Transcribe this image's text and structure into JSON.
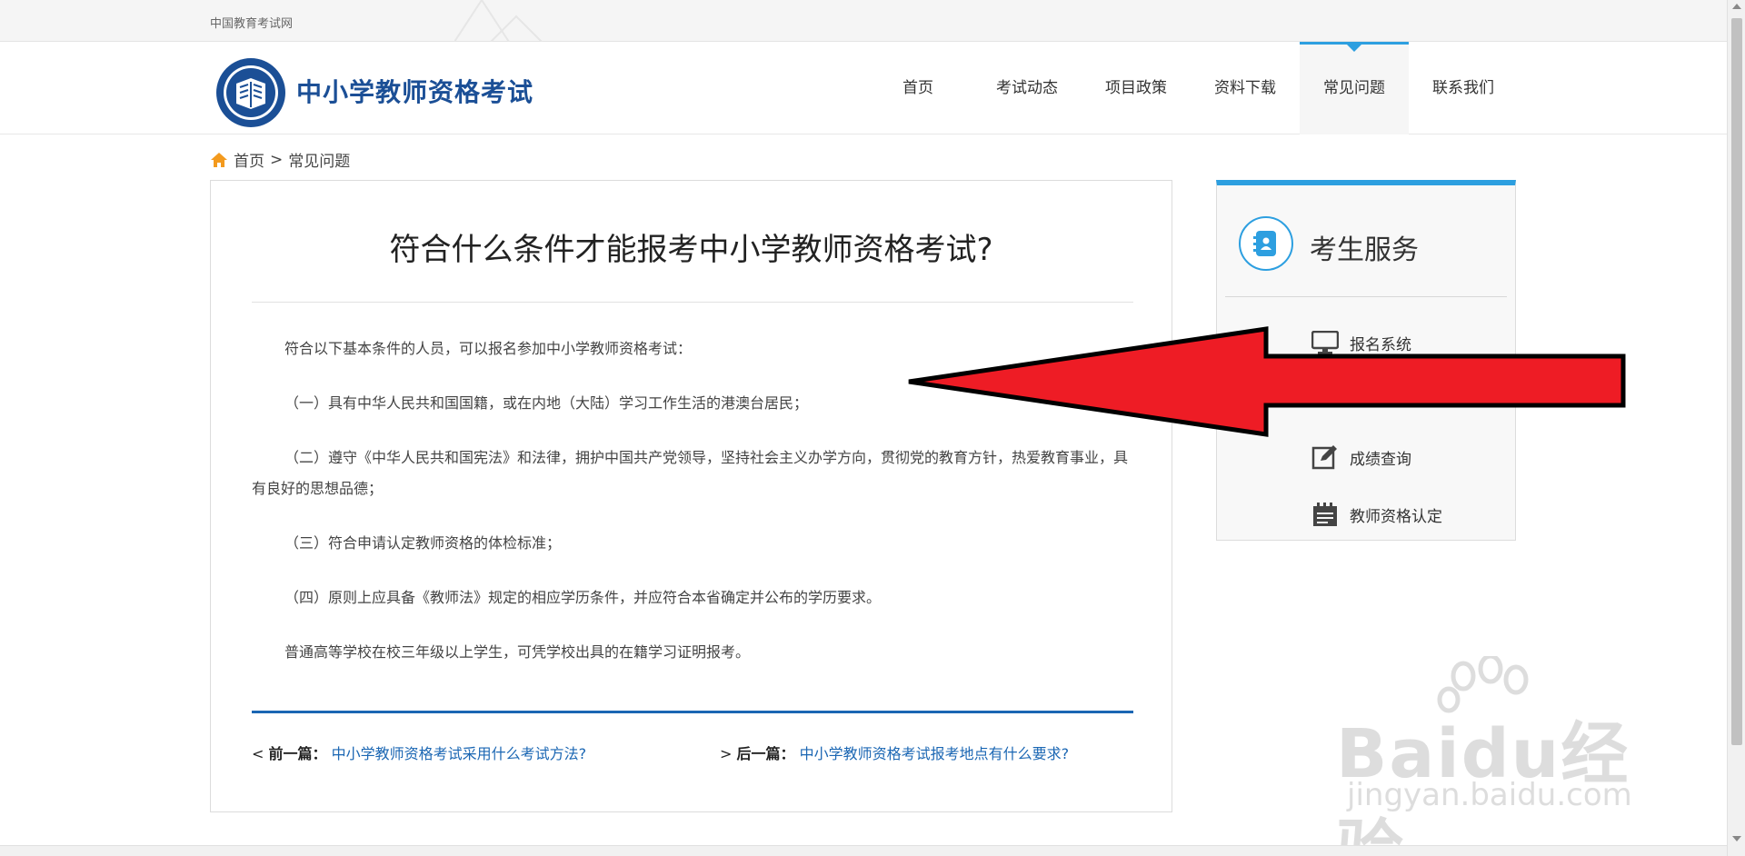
{
  "topbar": {
    "site_name": "中国教育考试网"
  },
  "header": {
    "title": "中小学教师资格考试",
    "nav": [
      {
        "label": "首页",
        "active": false
      },
      {
        "label": "考试动态",
        "active": false
      },
      {
        "label": "项目政策",
        "active": false
      },
      {
        "label": "资料下载",
        "active": false
      },
      {
        "label": "常见问题",
        "active": true
      },
      {
        "label": "联系我们",
        "active": false
      }
    ]
  },
  "breadcrumb": {
    "home": "首页",
    "sep": ">",
    "current": "常见问题"
  },
  "article": {
    "title": "符合什么条件才能报考中小学教师资格考试?",
    "paragraphs": [
      "符合以下基本条件的人员，可以报名参加中小学教师资格考试：",
      "（一）具有中华人民共和国国籍，或在内地（大陆）学习工作生活的港澳台居民；",
      "（二）遵守《中华人民共和国宪法》和法律，拥护中国共产党领导，坚持社会主义办学方向，贯彻党的教育方针，热爱教育事业，具有良好的思想品德；",
      "（三）符合申请认定教师资格的体检标准；",
      "（四）原则上应具备《教师法》规定的相应学历条件，并应符合本省确定并公布的学历要求。",
      "普通高等学校在校三年级以上学生，可凭学校出具的在籍学习证明报考。"
    ],
    "prev": {
      "arrow": "<",
      "label": "前一篇：",
      "link": "中小学教师资格考试采用什么考试方法?"
    },
    "next": {
      "arrow": ">",
      "label": "后一篇：",
      "link": "中小学教师资格考试报考地点有什么要求?"
    }
  },
  "sidebar": {
    "title": "考生服务",
    "items": [
      {
        "label": "报名系统",
        "icon": "monitor-icon"
      },
      {
        "label": "成绩查询",
        "icon": "edit-icon"
      },
      {
        "label": "教师资格认定",
        "icon": "calendar-icon"
      }
    ]
  },
  "watermark": {
    "brand": "Baidu经验",
    "url": "jingyan.baidu.com"
  },
  "colors": {
    "accent": "#2d9fe0",
    "brand": "#1b4f96",
    "link": "#1a66b3",
    "arrow": "#ee1c25"
  }
}
